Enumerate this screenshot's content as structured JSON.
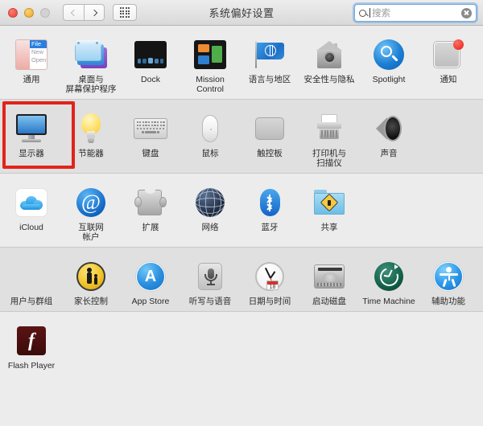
{
  "window": {
    "title": "系统偏好设置",
    "traffic_lights": [
      "close",
      "minimize",
      "zoom"
    ],
    "nav": {
      "back_label": "‹",
      "forward_label": "›",
      "grid_label": "show-all"
    }
  },
  "search": {
    "placeholder": "搜索",
    "value": "",
    "icon": "search-icon",
    "clear_icon": "clear-icon"
  },
  "accent": {
    "highlight_box": "#e2231a",
    "focus_ring": "#6eaae6",
    "row_alt_bg": "#e0e0e0",
    "row_bg": "#ececec"
  },
  "rows": [
    {
      "name": "personal",
      "shade": "plain",
      "items": [
        {
          "label": "通用",
          "icon": "general-icon"
        },
        {
          "label": "桌面与\n屏幕保护程序",
          "icon": "desktop-screensaver-icon"
        },
        {
          "label": "Dock",
          "icon": "dock-icon"
        },
        {
          "label": "Mission\nControl",
          "icon": "mission-control-icon"
        },
        {
          "label": "语言与地区",
          "icon": "language-region-icon"
        },
        {
          "label": "安全性与隐私",
          "icon": "security-privacy-icon"
        },
        {
          "label": "Spotlight",
          "icon": "spotlight-icon"
        },
        {
          "label": "通知",
          "icon": "notifications-icon"
        }
      ]
    },
    {
      "name": "hardware",
      "shade": "alt",
      "items": [
        {
          "label": "显示器",
          "icon": "displays-icon",
          "highlighted": true
        },
        {
          "label": "节能器",
          "icon": "energy-saver-icon"
        },
        {
          "label": "键盘",
          "icon": "keyboard-icon"
        },
        {
          "label": "鼠标",
          "icon": "mouse-icon"
        },
        {
          "label": "触控板",
          "icon": "trackpad-icon"
        },
        {
          "label": "打印机与\n扫描仪",
          "icon": "printers-scanners-icon"
        },
        {
          "label": "声音",
          "icon": "sound-icon"
        }
      ]
    },
    {
      "name": "internet-wireless",
      "shade": "plain",
      "items": [
        {
          "label": "iCloud",
          "icon": "icloud-icon"
        },
        {
          "label": "互联网\n帐户",
          "icon": "internet-accounts-icon"
        },
        {
          "label": "扩展",
          "icon": "extensions-icon"
        },
        {
          "label": "网络",
          "icon": "network-icon"
        },
        {
          "label": "蓝牙",
          "icon": "bluetooth-icon"
        },
        {
          "label": "共享",
          "icon": "sharing-icon"
        }
      ]
    },
    {
      "name": "system",
      "shade": "alt",
      "items": [
        {
          "label": "用户与群组",
          "icon": "users-groups-icon"
        },
        {
          "label": "家长控制",
          "icon": "parental-controls-icon"
        },
        {
          "label": "App Store",
          "icon": "app-store-icon"
        },
        {
          "label": "听写与语音",
          "icon": "dictation-speech-icon"
        },
        {
          "label": "日期与时间",
          "icon": "date-time-icon",
          "badge": "18"
        },
        {
          "label": "启动磁盘",
          "icon": "startup-disk-icon"
        },
        {
          "label": "Time Machine",
          "icon": "time-machine-icon"
        },
        {
          "label": "辅助功能",
          "icon": "accessibility-icon"
        }
      ]
    },
    {
      "name": "other",
      "shade": "plain",
      "items": [
        {
          "label": "Flash Player",
          "icon": "flash-player-icon"
        }
      ]
    }
  ]
}
